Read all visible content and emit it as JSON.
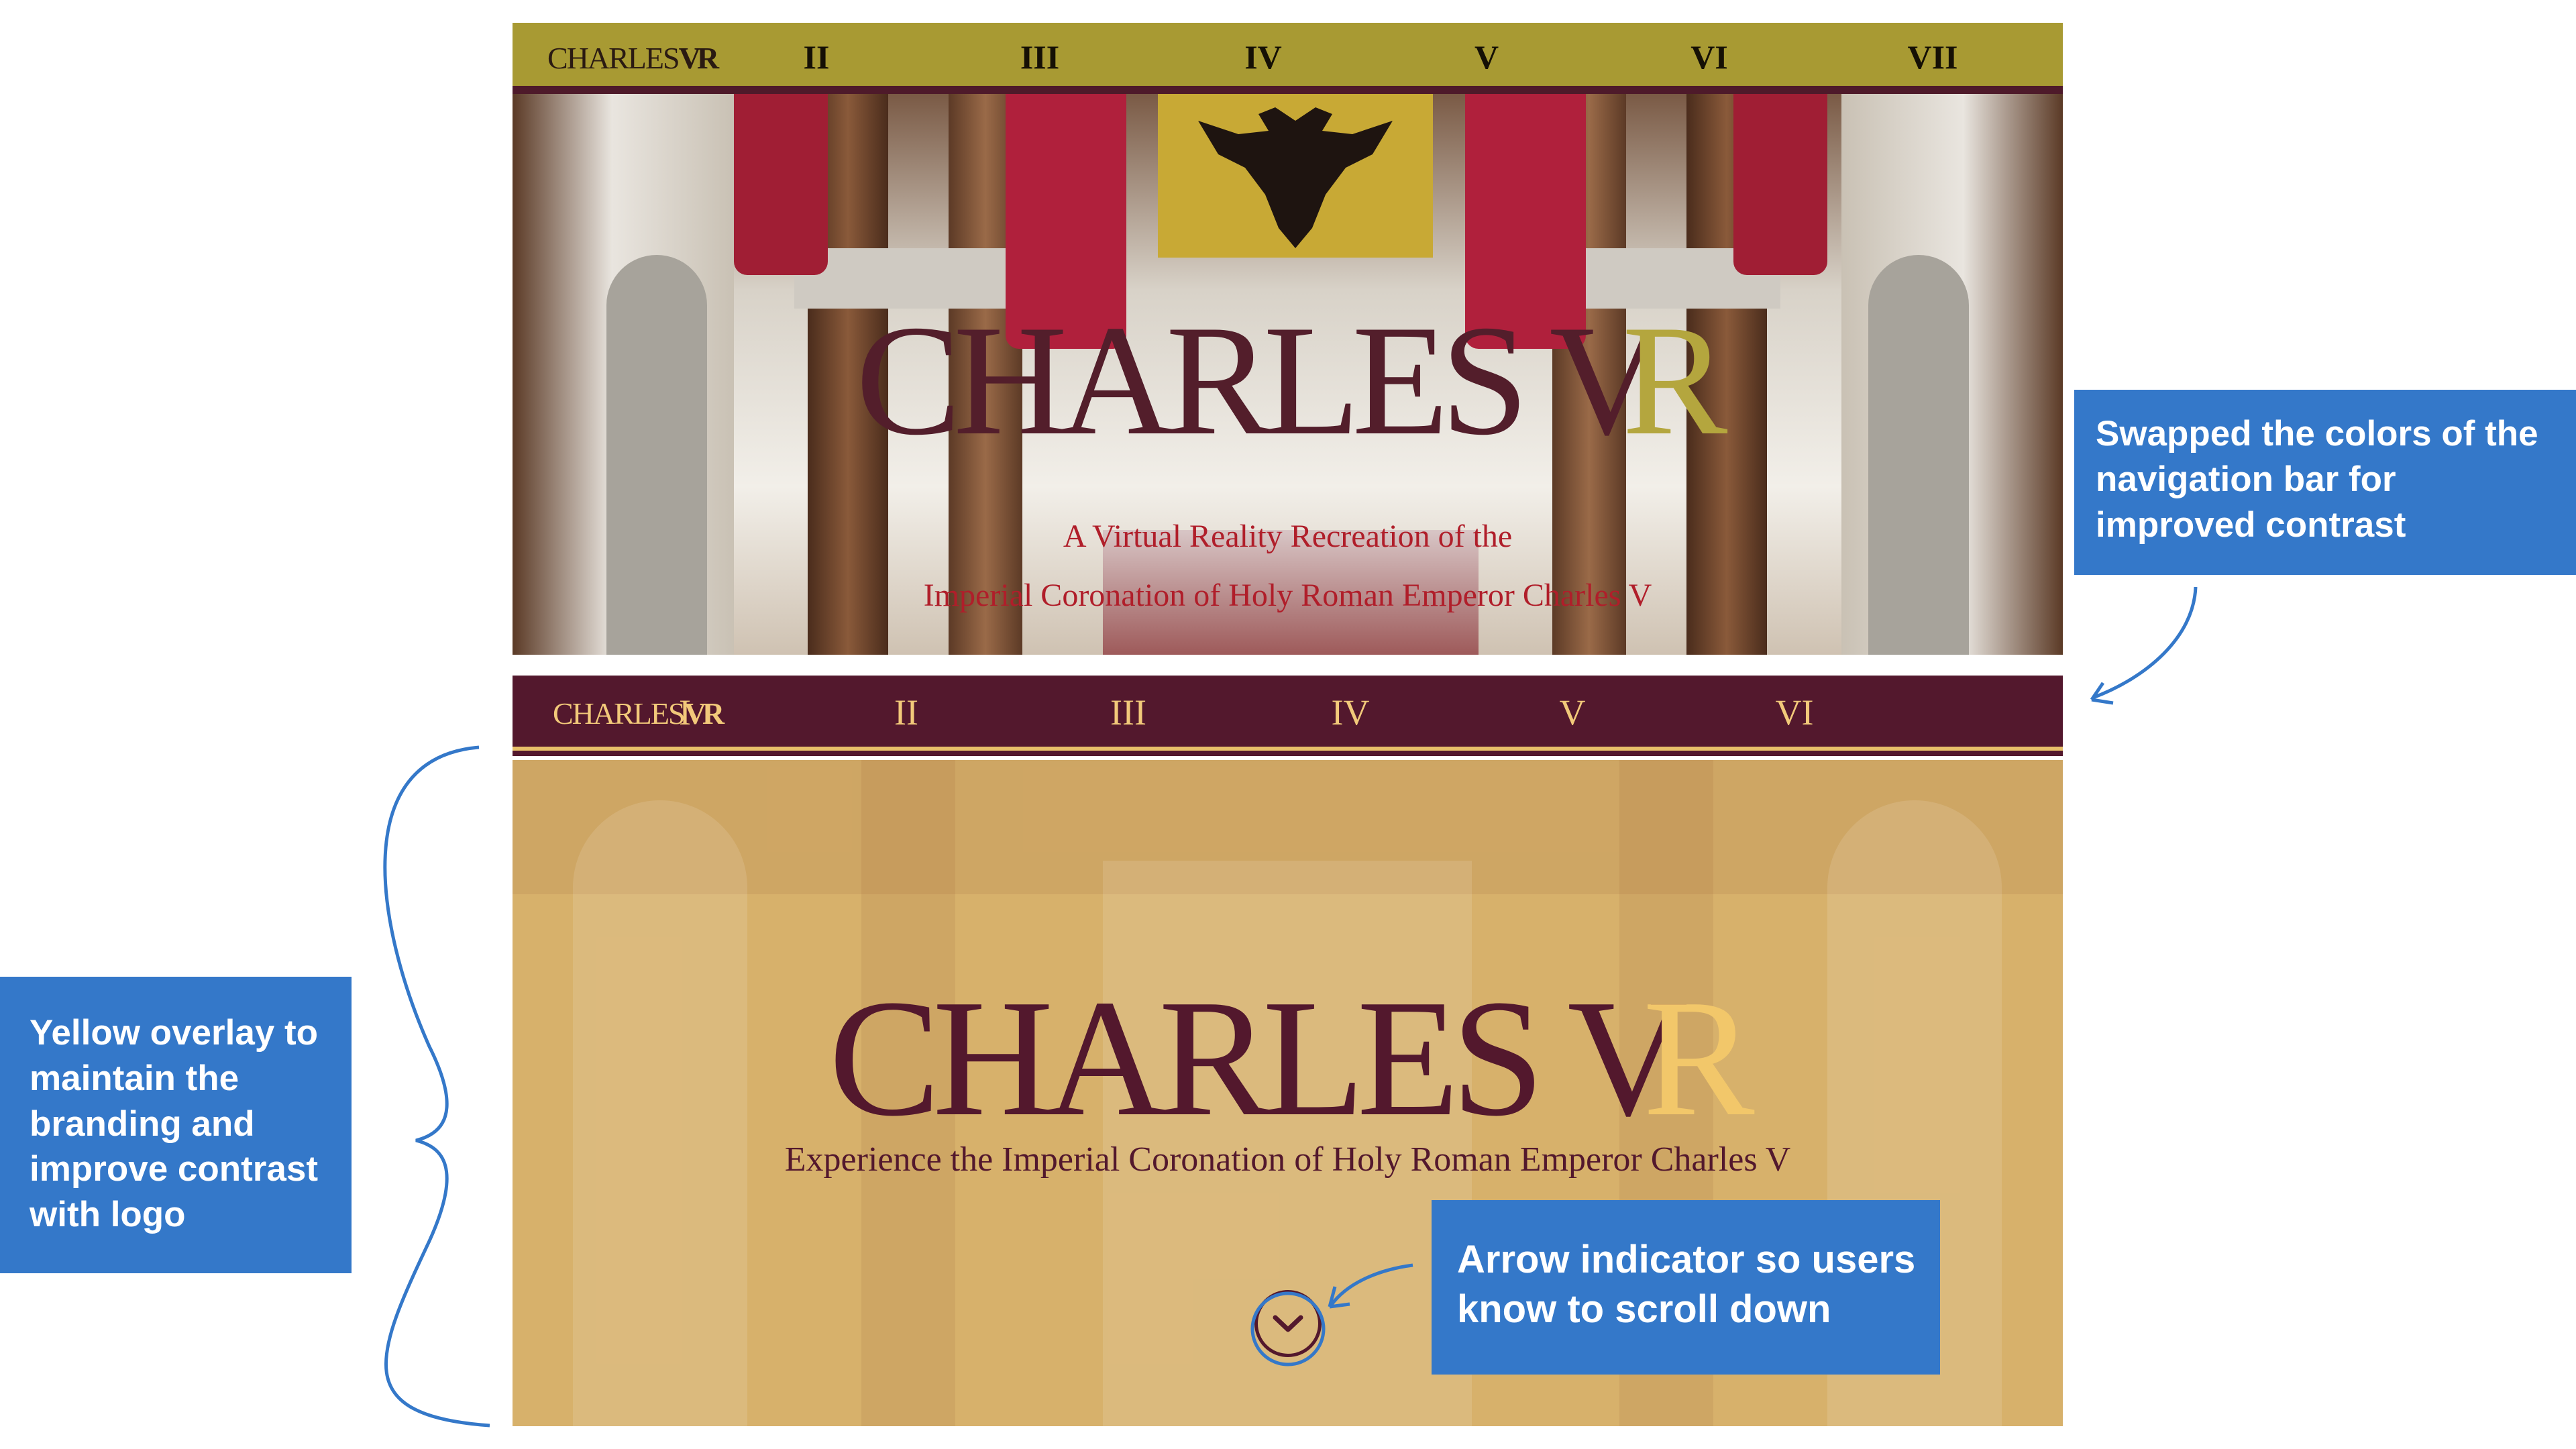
{
  "old_panel": {
    "nav": {
      "logo_main": "CHARLES",
      "logo_accent": "VR",
      "items": [
        "II",
        "III",
        "IV",
        "V",
        "VI",
        "VII"
      ],
      "background": "#a89a33",
      "text_color": "#151005"
    },
    "hero": {
      "title_main": "CHARLES V",
      "title_accent": "R",
      "subtitle_line1": "A Virtual Reality Recreation of the",
      "subtitle_line2": "Imperial Coronation of Holy Roman Emperor Charles V",
      "title_color": "#531e2b",
      "subtitle_color": "#b01e2a"
    }
  },
  "new_panel": {
    "nav": {
      "logo_main": "CHARLES",
      "logo_accent": "VR",
      "items": [
        "I",
        "II",
        "III",
        "IV",
        "V",
        "VI"
      ],
      "background": "#53182d",
      "text_color": "#f2c97a"
    },
    "hero": {
      "title_main": "CHARLES V",
      "title_accent": "R",
      "tagline": "Experience the Imperial Coronation of Holy Roman Emperor Charles V",
      "overlay_color": "#d7b16b",
      "scroll_icon": "chevron-down-icon"
    }
  },
  "annotations": {
    "nav_swap": "Swapped the colors of the navigation bar for improved contrast",
    "overlay": "Yellow overlay to maintain the branding and improve contrast with logo",
    "arrow": "Arrow indicator so users know to scroll down",
    "color": "#3478c9"
  }
}
